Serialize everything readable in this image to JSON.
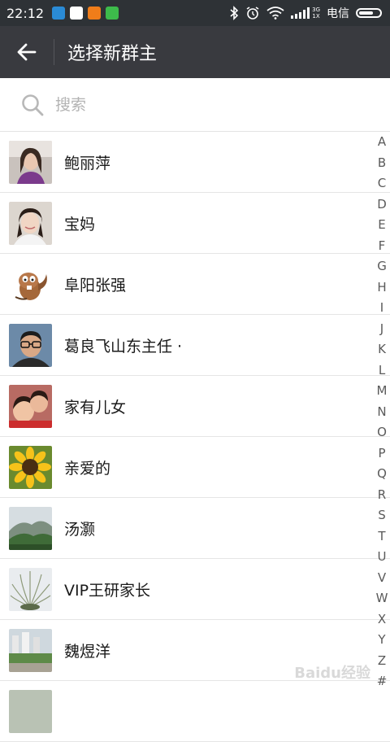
{
  "status_bar": {
    "time": "22:12",
    "network_top": "3G",
    "network_bottom": "1X",
    "carrier": "电信"
  },
  "app_bar": {
    "title": "选择新群主"
  },
  "search": {
    "placeholder": "搜索"
  },
  "contacts": [
    {
      "name": "鲍丽萍",
      "avatar": "woman-purple-scarf"
    },
    {
      "name": "宝妈",
      "avatar": "woman-selfie"
    },
    {
      "name": "阜阳张强",
      "avatar": "cartoon-squirrel"
    },
    {
      "name": "葛良飞山东主任 ·",
      "avatar": "man-glasses"
    },
    {
      "name": "家有儿女",
      "avatar": "children-photo"
    },
    {
      "name": "亲爱的",
      "avatar": "sunflower"
    },
    {
      "name": "汤灏",
      "avatar": "mountain-landscape"
    },
    {
      "name": "VIP王研家长",
      "avatar": "ornamental-grass"
    },
    {
      "name": "魏煜洋",
      "avatar": "city-park"
    }
  ],
  "alphabet_index": [
    "A",
    "B",
    "C",
    "D",
    "E",
    "F",
    "G",
    "H",
    "I",
    "J",
    "K",
    "L",
    "M",
    "N",
    "O",
    "P",
    "Q",
    "R",
    "S",
    "T",
    "U",
    "V",
    "W",
    "X",
    "Y",
    "Z",
    "#"
  ],
  "watermark": "Baidu经验"
}
